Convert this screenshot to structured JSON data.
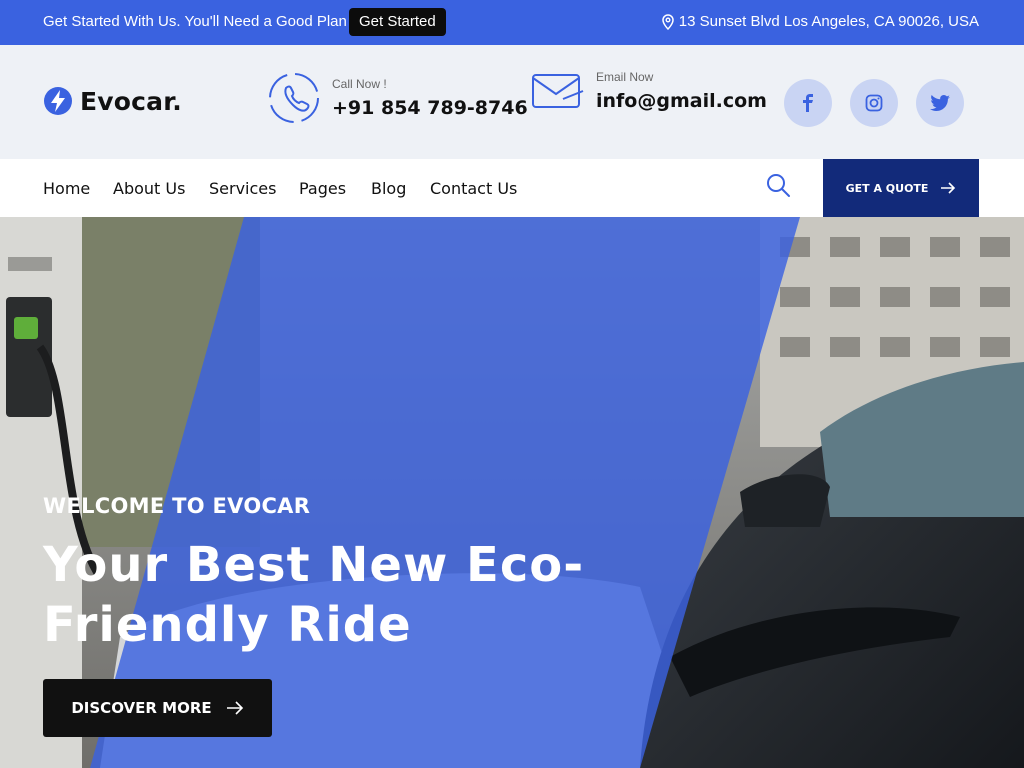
{
  "topbar": {
    "promo": "Get Started With Us. You'll Need a Good Plan",
    "start_label": "Get Started",
    "address": "13 Sunset Blvd Los Angeles, CA 90026, USA"
  },
  "brand": {
    "name": "Evocar."
  },
  "contact": {
    "phone": {
      "label": "Call Now !",
      "value": "+91 854 789-8746"
    },
    "email": {
      "label": "Email Now",
      "value": "info@gmail.com"
    }
  },
  "social": [
    "facebook-icon",
    "instagram-icon",
    "twitter-icon"
  ],
  "nav": {
    "items": [
      "Home",
      "About Us",
      "Services",
      "Pages",
      "Blog",
      "Contact Us"
    ],
    "quote_label": "GET A QUOTE"
  },
  "hero": {
    "eyebrow": "WELCOME TO EVOCAR",
    "title": "Your Best New Eco-Friendly Ride",
    "cta": "DISCOVER MORE"
  },
  "colors": {
    "accent": "#3a62e0",
    "dark_navy": "#122a7a",
    "social_bg": "#c9d4f3"
  }
}
